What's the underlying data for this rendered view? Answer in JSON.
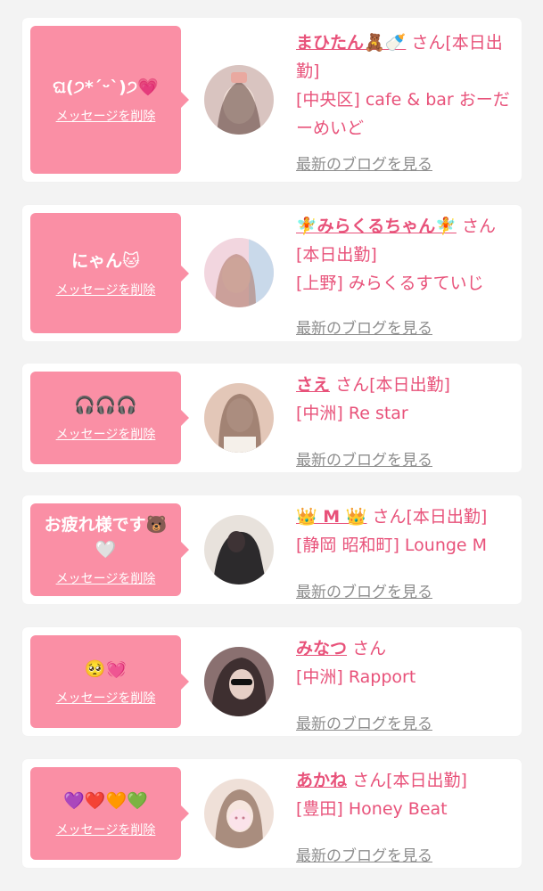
{
  "delete_label": "メッセージを削除",
  "blog_label": "最新のブログを見る",
  "san": "さん",
  "items": [
    {
      "message": "ଘ(੭*ˊᵕˋ)੭💗",
      "name": "まひたん🧸🍼",
      "status": "[本日出勤]",
      "shop": "[中央区] cafe & bar おーだーめいど",
      "avatar_colors": [
        "#d9c4c0",
        "#7a5b52"
      ]
    },
    {
      "message": "にゃん🐱",
      "name": "🧚みらくるちゃん🧚",
      "status": "[本日出勤]",
      "shop": "[上野] みらくるすていじ",
      "avatar_colors": [
        "#f2d6df",
        "#b78a93"
      ]
    },
    {
      "message": "🎧🎧🎧",
      "name": "さえ",
      "status": "[本日出勤]",
      "shop": "[中洲] Re star",
      "avatar_colors": [
        "#e3c7b8",
        "#6e4a3c"
      ]
    },
    {
      "message": "お疲れ様です🐻🤍",
      "name": "👑 M 👑",
      "status": "[本日出勤]",
      "shop": "[静岡 昭和町] Lounge M",
      "avatar_colors": [
        "#e8e2dc",
        "#2c2a2c"
      ]
    },
    {
      "message": "🥺💓",
      "name": "みなつ",
      "status": "",
      "shop": "[中洲] Rapport",
      "avatar_colors": [
        "#8a7070",
        "#2a1f20"
      ]
    },
    {
      "message": "💜❤️🧡💚",
      "name": "あかね",
      "status": "[本日出勤]",
      "shop": "[豊田] Honey Beat",
      "avatar_colors": [
        "#efe0d8",
        "#8b6a58"
      ]
    }
  ]
}
